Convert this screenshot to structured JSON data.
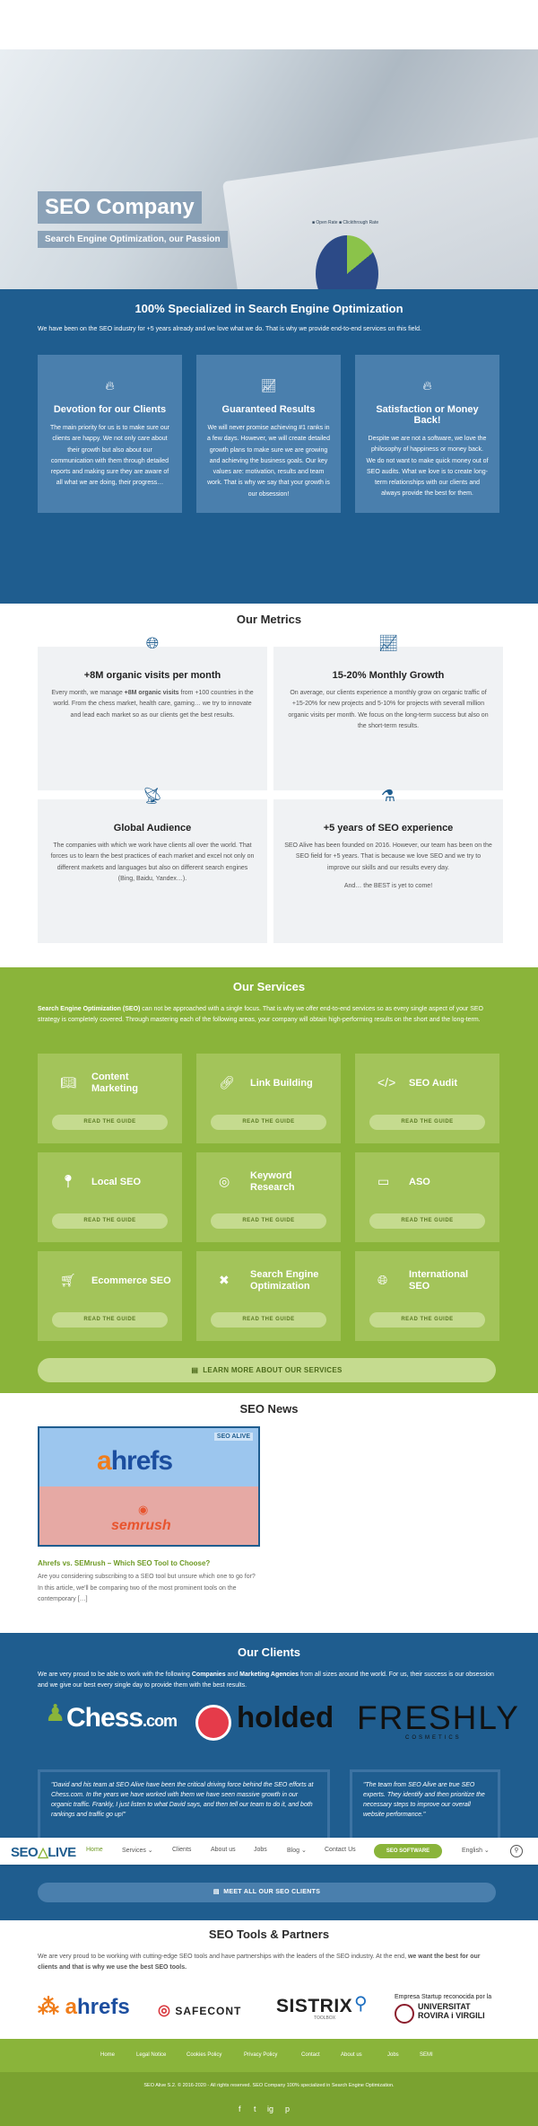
{
  "hero": {
    "title": "SEO Company",
    "subtitle": "Search Engine Optimization, our Passion",
    "chart_legend": "■ Open Rate  ■ Clickthrough Rate"
  },
  "specialized": {
    "title": "100% Specialized in Search Engine Optimization",
    "intro": "We have been on the SEO industry for +5 years already and we love what we do. That is why we provide end-to-end services on this field.",
    "cards": [
      {
        "icon": "fire-icon",
        "title": "Devotion for our Clients",
        "text": "The main priority for us is to make sure our clients are happy. We not only care about their growth but also about our communication with them through detailed reports and making sure they are aware of all what we are doing, their progress…"
      },
      {
        "icon": "chart-icon",
        "title": "Guaranteed Results",
        "text": "We will never promise achieving #1 ranks in a few days. However, we will create detailed growth plans to make sure we are growing and achieving the business goals. Our key values are: motivation, results and team work. That is why we say that your growth is our obsession!"
      },
      {
        "icon": "fire-icon",
        "title": "Satisfaction or Money Back!",
        "text": "Despite we are not a software, we love the philosophy of happiness or money back. We do not want to make quick money out of SEO audits. What we love is to create long-term relationships with our clients and always provide the best for them."
      }
    ]
  },
  "metrics": {
    "title": "Our Metrics",
    "items": [
      {
        "icon": "globe-icon",
        "title": "+8M organic visits per month",
        "text_before": "Every month, we manage ",
        "text_bold": "+8M organic visits",
        "text_after": " from +100 countries in the world. From the chess market, health care, gaming… we try to innovate and lead each market so as our clients get the best results."
      },
      {
        "icon": "chart-icon",
        "title": "15-20% Monthly Growth",
        "text_before": "On average, our clients experience a monthly grow on organic traffic of +15-20% for new projects and 5-10% for projects with severall million organic visits per month. We focus on the long-term success but also on the short-term results.",
        "text_bold": "",
        "text_after": ""
      },
      {
        "icon": "podcast-icon",
        "title": "Global Audience",
        "text_before": "The companies with which we work have clients all over the world. That forces us to learn the best practices of each market and excel not only on different markets and languages but also on different search engines (Bing, Baidu, Yandex…).",
        "text_bold": "",
        "text_after": ""
      },
      {
        "icon": "flask-icon",
        "title": "+5 years of SEO experience",
        "text_before": "SEO Alive has been founded on 2016. However, our team has been on the SEO field for +5 years. That is because we love SEO and we try to improve our skills and our results every day.",
        "text_bold": "",
        "text_after": "",
        "extra": "And… the BEST is yet to come!"
      }
    ]
  },
  "services": {
    "title": "Our Services",
    "intro_bold": "Search Engine Optimization (SEO)",
    "intro_rest": " can not be approached with a single focus. That is why we offer end-to-end services so as every single aspect of your SEO strategy is completely covered. Through mastering each of the following areas, your company will obtain high-performing results on the short and the long-term.",
    "button_label": "READ THE GUIDE",
    "items": [
      {
        "icon": "book-icon",
        "label": "Content Marketing"
      },
      {
        "icon": "link-icon",
        "label": "Link Building"
      },
      {
        "icon": "code-icon",
        "label": "SEO Audit"
      },
      {
        "icon": "map-marker-icon",
        "label": "Local SEO"
      },
      {
        "icon": "target-icon",
        "label": "Keyword Research"
      },
      {
        "icon": "tablet-icon",
        "label": "ASO"
      },
      {
        "icon": "cart-icon",
        "label": "Ecommerce SEO"
      },
      {
        "icon": "tools-icon",
        "label": "Search Engine Optimization"
      },
      {
        "icon": "globe-icon",
        "label": "International SEO"
      }
    ],
    "learn_more": "LEARN MORE ABOUT OUR SERVICES"
  },
  "news": {
    "title": "SEO News",
    "image_ahrefs": "ahrefs",
    "image_semrush": "semrush",
    "image_brand": "SEO ALIVE",
    "post_title": "Ahrefs vs. SEMrush – Which SEO Tool to Choose?",
    "excerpt": "Are you considering subscribing to a SEO tool but unsure which one to go for? In this article, we'll be comparing two of the most prominent tools on the contemporary […]"
  },
  "clients": {
    "title": "Our Clients",
    "intro_1": "We are very proud to be able to work with the following ",
    "intro_b1": "Companies",
    "intro_2": " and ",
    "intro_b2": "Marketing Agencies",
    "intro_3": " from all sizes around the world. For us, their success is our obsession and we give our best every single day to provide them with the best results.",
    "logo_chess": "Chess",
    "logo_chess_com": ".com",
    "logo_holded": "holded",
    "logo_freshly": "FRESHLY",
    "logo_freshly_sub": "COSMETICS",
    "quote1": "\"David and his team at SEO Alive have been the critical driving force behind the SEO efforts at Chess.com. In the years we have worked with them we have seen massive growth in our organic traffic. Frankly, I just listen to what David says, and then tell our team to do it, and both rankings and traffic go up!\"",
    "quote2": "\"The team from SEO Alive are true SEO experts. They identify and then prioritize the necessary steps to improve our overall website performance.\"",
    "meet_button": "MEET ALL OUR SEO CLIENTS"
  },
  "nav": {
    "logo_seo": "SEO",
    "logo_alive": "LIVE",
    "items": [
      "Home",
      "Services",
      "Clients",
      "About us",
      "Jobs",
      "Blog",
      "Contact Us"
    ],
    "software": "SEO SOFTWARE",
    "language": "English"
  },
  "tools": {
    "title": "SEO Tools & Partners",
    "intro": "We are very proud to be working with cutting-edge SEO tools and have partnerships with the leaders of the SEO industry. At the end, ",
    "intro_bold": "we want the best for our clients and that is why we use the best SEO tools.",
    "ahrefs": "hrefs",
    "safecont": "SAFECONT",
    "sistrix": "SISTRIX",
    "sistrix_sub": "TOOLBOX",
    "urv_top": "Empresa Startup reconocida por la",
    "urv_bottom": "UNIVERSITAT\nROVIRA i VIRGILI"
  },
  "footer": {
    "links": [
      "Home",
      "Legal Notice",
      "Cookies Policy",
      "Privacy Policy",
      "Contact",
      "About us",
      "Jobs",
      "SEMI"
    ],
    "copyright": "SEO Alive S.2. © 2016-2020 - All rights reserved. SEO Company 100% specialized in Search Engine Optimization.",
    "social": [
      "f",
      "t",
      "ig",
      "p"
    ]
  },
  "colors": {
    "primary_blue": "#1f5d8f",
    "accent_green": "#8ab43a"
  }
}
